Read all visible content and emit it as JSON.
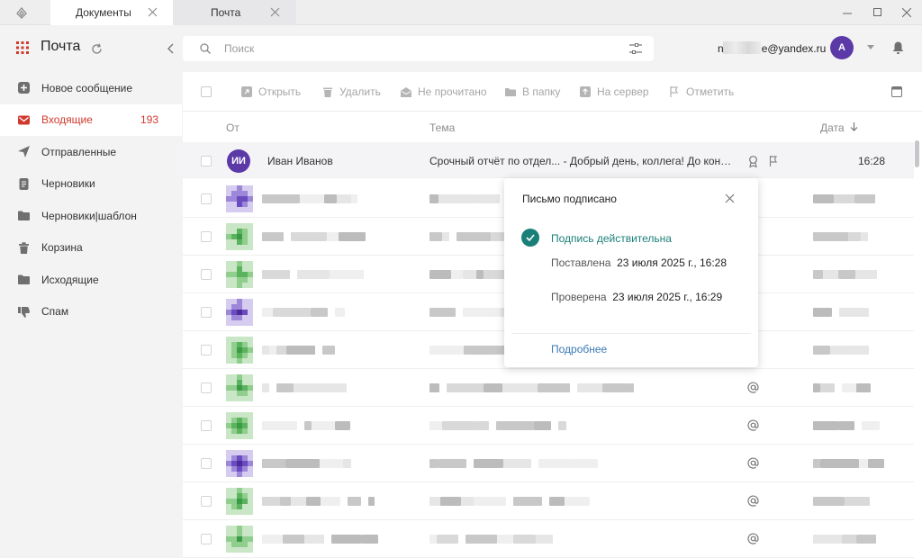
{
  "tabs": [
    {
      "label": "Документы"
    },
    {
      "label": "Почта"
    }
  ],
  "sidebar": {
    "title": "Почта",
    "items": [
      {
        "label": "Новое сообщение",
        "icon": "plus-square-icon"
      },
      {
        "label": "Входящие",
        "icon": "envelope-icon",
        "count": "193"
      },
      {
        "label": "Отправленные",
        "icon": "paper-plane-icon"
      },
      {
        "label": "Черновики",
        "icon": "document-icon"
      },
      {
        "label": "Черновики|шаблон",
        "icon": "folder-icon"
      },
      {
        "label": "Корзина",
        "icon": "trash-icon"
      },
      {
        "label": "Исходящие",
        "icon": "folder-icon"
      },
      {
        "label": "Спам",
        "icon": "thumb-down-icon"
      }
    ]
  },
  "search": {
    "placeholder": "Поиск"
  },
  "user": {
    "email_prefix": "n",
    "email_suffix": "e@yandex.ru",
    "avatar_letter": "A"
  },
  "toolbar": {
    "open": "Открыть",
    "delete": "Удалить",
    "unread": "Не прочитано",
    "to_folder": "В папку",
    "to_server": "На сервер",
    "mark": "Отметить"
  },
  "columns": {
    "from": "От",
    "subject": "Тема",
    "date": "Дата"
  },
  "first_message": {
    "initials": "ИИ",
    "sender": "Иван Иванов",
    "subject": "Срочный отчёт по отдел... - Добрый день, коллега! До конца ве...",
    "time": "16:28"
  },
  "popup": {
    "title": "Письмо подписано",
    "status": "Подпись действительна",
    "placed_label": "Поставлена",
    "placed_value": "23 июля 2025 г., 16:28",
    "checked_label": "Проверена",
    "checked_value": "23 июля 2025 г., 16:29",
    "more": "Подробнее"
  },
  "colors": {
    "accent": "#d0392e",
    "avatar": "#5b3aa8",
    "success": "#1a7f78",
    "link": "#3b79b5"
  }
}
